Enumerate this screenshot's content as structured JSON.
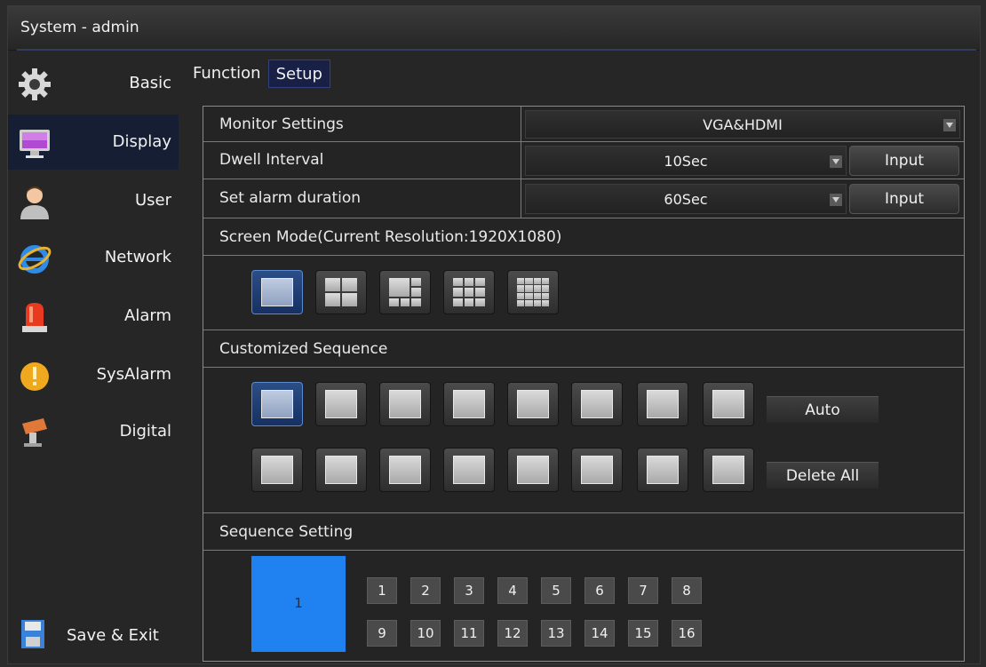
{
  "window": {
    "title": "System - admin"
  },
  "sidebar": {
    "items": [
      {
        "label": "Basic",
        "icon": "gear-icon"
      },
      {
        "label": "Display",
        "icon": "monitor-icon"
      },
      {
        "label": "User",
        "icon": "user-icon"
      },
      {
        "label": "Network",
        "icon": "internet-explorer-icon"
      },
      {
        "label": "Alarm",
        "icon": "alarm-light-icon"
      },
      {
        "label": "SysAlarm",
        "icon": "warning-icon"
      },
      {
        "label": "Digital",
        "icon": "digital-camera-icon"
      }
    ],
    "active_item": "Display",
    "save_exit": {
      "label": "Save & Exit",
      "icon": "floppy-disk-icon"
    }
  },
  "tabs": [
    {
      "label": "Function"
    },
    {
      "label": "Setup"
    }
  ],
  "active_tab": "Setup",
  "settings": {
    "monitor": {
      "label": "Monitor Settings",
      "value": "VGA&HDMI"
    },
    "dwell": {
      "label": "Dwell Interval",
      "value": "10Sec",
      "button": "Input"
    },
    "alarm_duration": {
      "label": "Set alarm duration",
      "value": "60Sec",
      "button": "Input"
    }
  },
  "screen_mode": {
    "label": "Screen Mode(Current Resolution:1920X1080)",
    "modes": [
      "1-split",
      "4-split",
      "6-split",
      "9-split",
      "16-split"
    ],
    "selected_mode": "1-split"
  },
  "customized_sequence": {
    "label": "Customized Sequence",
    "auto_label": "Auto",
    "delete_all_label": "Delete All",
    "selected_slot": 1
  },
  "sequence_setting": {
    "label": "Sequence Setting",
    "current": "1",
    "channels_row1": [
      "1",
      "2",
      "3",
      "4",
      "5",
      "6",
      "7",
      "8"
    ],
    "channels_row2": [
      "9",
      "10",
      "11",
      "12",
      "13",
      "14",
      "15",
      "16"
    ]
  },
  "colors": {
    "accent": "#1f82f0",
    "active_bg": "#151e33",
    "tab_active": "#182046"
  }
}
